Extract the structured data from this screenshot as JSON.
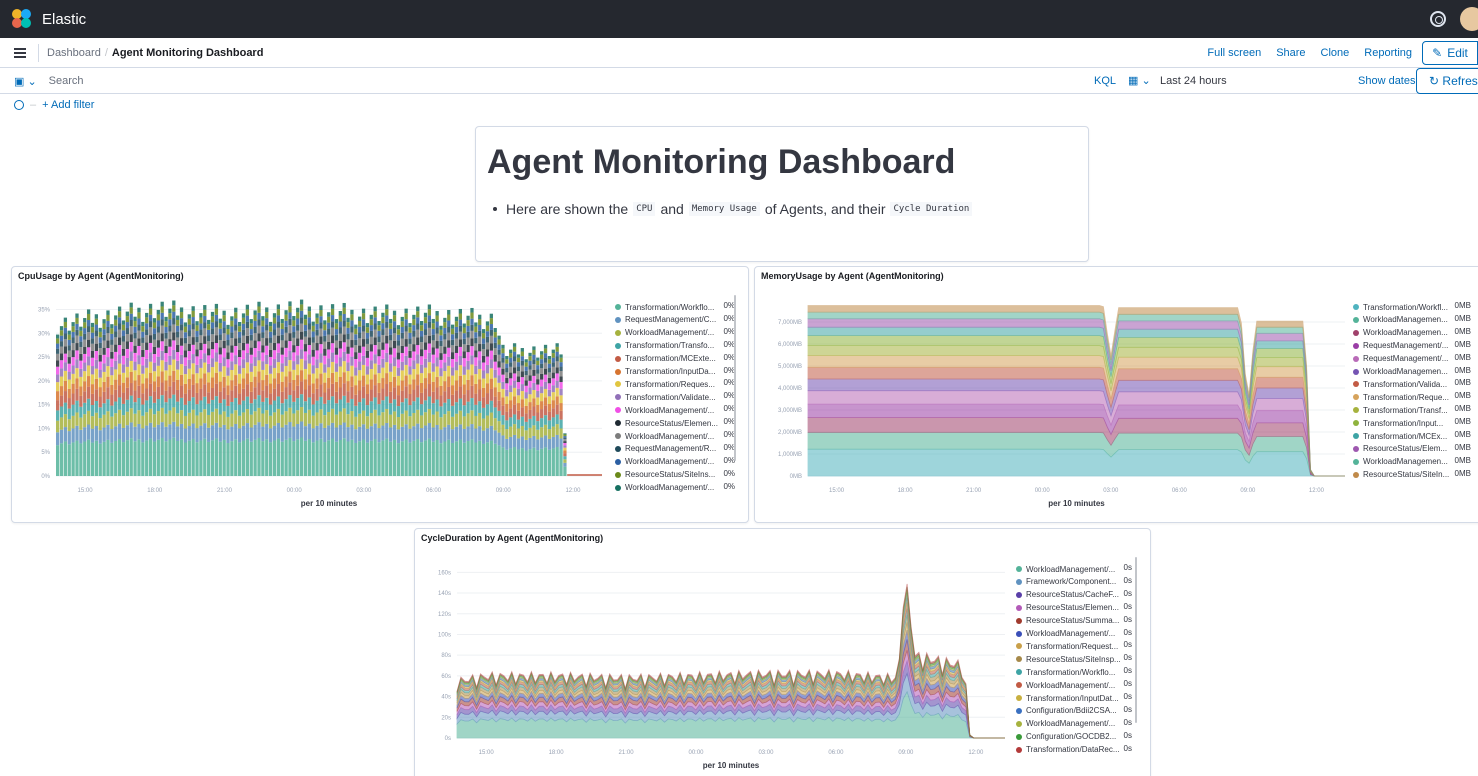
{
  "header": {
    "app_title": "Elastic"
  },
  "breadcrumbs": {
    "root": "Dashboard",
    "separator": "/",
    "current": "Agent Monitoring Dashboard"
  },
  "nav": {
    "full_screen": "Full screen",
    "share": "Share",
    "clone": "Clone",
    "reporting": "Reporting",
    "edit": "Edit"
  },
  "query": {
    "placeholder": "Search",
    "language": "KQL",
    "date_range": "Last 24 hours",
    "show_dates": "Show dates",
    "refresh": "Refresh"
  },
  "filters": {
    "add_filter": "+ Add filter"
  },
  "markdown": {
    "title": "Agent Monitoring Dashboard",
    "text_1": "Here are shown the",
    "code_1": "CPU",
    "text_2": "and",
    "code_2": "Memory Usage",
    "text_3": "of Agents, and their",
    "code_3": "Cycle Duration"
  },
  "panels": {
    "cpu": {
      "title": "CpuUsage by Agent (AgentMonitoring)",
      "legend": [
        {
          "label": "Transformation/Workflo...",
          "value": "0%",
          "color": "#54b399"
        },
        {
          "label": "RequestManagement/C...",
          "value": "0%",
          "color": "#6092c0"
        },
        {
          "label": "WorkloadManagement/...",
          "value": "0%",
          "color": "#a6b23e"
        },
        {
          "label": "Transformation/Transfo...",
          "value": "0%",
          "color": "#3ea4a5"
        },
        {
          "label": "Transformation/MCExte...",
          "value": "0%",
          "color": "#c25b45"
        },
        {
          "label": "Transformation/InputDa...",
          "value": "0%",
          "color": "#d7742f"
        },
        {
          "label": "Transformation/Reques...",
          "value": "0%",
          "color": "#e1c640"
        },
        {
          "label": "Transformation/Validate...",
          "value": "0%",
          "color": "#9170b8"
        },
        {
          "label": "WorkloadManagement/...",
          "value": "0%",
          "color": "#f04fe6"
        },
        {
          "label": "ResourceStatus/Elemen...",
          "value": "0%",
          "color": "#1f2a33"
        },
        {
          "label": "WorkloadManagement/...",
          "value": "0%",
          "color": "#7c7c7c"
        },
        {
          "label": "RequestManagement/R...",
          "value": "0%",
          "color": "#1f4a5a"
        },
        {
          "label": "WorkloadManagement/...",
          "value": "0%",
          "color": "#2c5fa3"
        },
        {
          "label": "ResourceStatus/SiteIns...",
          "value": "0%",
          "color": "#6b8a1a"
        },
        {
          "label": "WorkloadManagement/...",
          "value": "0%",
          "color": "#167061"
        }
      ]
    },
    "memory": {
      "title": "MemoryUsage by Agent (AgentMonitoring)",
      "legend": [
        {
          "label": "Transformation/Workfl...",
          "value": "0MB",
          "color": "#4fb3bf"
        },
        {
          "label": "WorkloadManagemen...",
          "value": "0MB",
          "color": "#54b399"
        },
        {
          "label": "WorkloadManagemen...",
          "value": "0MB",
          "color": "#a0416b"
        },
        {
          "label": "RequestManagement/...",
          "value": "0MB",
          "color": "#9a3ea6"
        },
        {
          "label": "RequestManagement/...",
          "value": "0MB",
          "color": "#b96bb8"
        },
        {
          "label": "WorkloadManagemen...",
          "value": "0MB",
          "color": "#7554b3"
        },
        {
          "label": "Transformation/Valida...",
          "value": "0MB",
          "color": "#c25b45"
        },
        {
          "label": "Transformation/Reque...",
          "value": "0MB",
          "color": "#d6a35c"
        },
        {
          "label": "Transformation/Transf...",
          "value": "0MB",
          "color": "#a6b23e"
        },
        {
          "label": "Transformation/Input...",
          "value": "0MB",
          "color": "#8fb33e"
        },
        {
          "label": "Transformation/MCEx...",
          "value": "0MB",
          "color": "#3ea4a5"
        },
        {
          "label": "ResourceStatus/Elem...",
          "value": "0MB",
          "color": "#9e58b0"
        },
        {
          "label": "WorkloadManagemen...",
          "value": "0MB",
          "color": "#54b399"
        },
        {
          "label": "ResourceStatus/SiteIn...",
          "value": "0MB",
          "color": "#c08a4a"
        }
      ]
    },
    "cycle": {
      "title": "CycleDuration by Agent (AgentMonitoring)",
      "legend": [
        {
          "label": "WorkloadManagement/...",
          "value": "0s",
          "color": "#54b399"
        },
        {
          "label": "Framework/Component...",
          "value": "0s",
          "color": "#6092c0"
        },
        {
          "label": "ResourceStatus/CacheF...",
          "value": "0s",
          "color": "#5a3fa8"
        },
        {
          "label": "ResourceStatus/Elemen...",
          "value": "0s",
          "color": "#b35ab8"
        },
        {
          "label": "ResourceStatus/Summa...",
          "value": "0s",
          "color": "#a03a2e"
        },
        {
          "label": "WorkloadManagement/...",
          "value": "0s",
          "color": "#3a4fb8"
        },
        {
          "label": "Transformation/Request...",
          "value": "0s",
          "color": "#c9a04a"
        },
        {
          "label": "ResourceStatus/SiteInsp...",
          "value": "0s",
          "color": "#a6894a"
        },
        {
          "label": "Transformation/Workflo...",
          "value": "0s",
          "color": "#3ea4a5"
        },
        {
          "label": "WorkloadManagement/...",
          "value": "0s",
          "color": "#c25b45"
        },
        {
          "label": "Transformation/InputDat...",
          "value": "0s",
          "color": "#c8b040"
        },
        {
          "label": "Configuration/Bdii2CSA...",
          "value": "0s",
          "color": "#3a70c0"
        },
        {
          "label": "WorkloadManagement/...",
          "value": "0s",
          "color": "#a6b23e"
        },
        {
          "label": "Configuration/GOCDB2...",
          "value": "0s",
          "color": "#3a9a3a"
        },
        {
          "label": "Transformation/DataRec...",
          "value": "0s",
          "color": "#b33a3a"
        }
      ]
    }
  },
  "chart_data": [
    {
      "type": "bar",
      "title": "CpuUsage by Agent (AgentMonitoring)",
      "xlabel": "per 10 minutes",
      "ylabel": "",
      "x_ticks": [
        "15:00",
        "18:00",
        "21:00",
        "00:00",
        "03:00",
        "06:00",
        "09:00",
        "12:00"
      ],
      "y_ticks": [
        "0%",
        "5%",
        "10%",
        "15%",
        "20%",
        "25%",
        "30%",
        "35%"
      ],
      "ylim": [
        0,
        37
      ],
      "stacked": true,
      "x_range_hours": [
        13,
        13.5
      ],
      "total_profile": [
        {
          "x": "13:45",
          "y": 29
        },
        {
          "x": "15:00",
          "y": 30
        },
        {
          "x": "18:00",
          "y": 32
        },
        {
          "x": "21:00",
          "y": 31
        },
        {
          "x": "00:00",
          "y": 32
        },
        {
          "x": "03:00",
          "y": 31
        },
        {
          "x": "06:00",
          "y": 31
        },
        {
          "x": "08:40",
          "y": 30
        },
        {
          "x": "09:00",
          "y": 24
        },
        {
          "x": "11:30",
          "y": 24
        },
        {
          "x": "11:45",
          "y": 0
        },
        {
          "x": "13:15",
          "y": 0
        }
      ]
    },
    {
      "type": "area",
      "title": "MemoryUsage by Agent (AgentMonitoring)",
      "xlabel": "per 10 minutes",
      "x_ticks": [
        "15:00",
        "18:00",
        "21:00",
        "00:00",
        "03:00",
        "06:00",
        "09:00",
        "12:00"
      ],
      "y_ticks": [
        "0MB",
        "1,000MB",
        "2,000MB",
        "3,000MB",
        "4,000MB",
        "5,000MB",
        "6,000MB",
        "7,000MB"
      ],
      "ylim": [
        0,
        8000
      ],
      "stacked": true,
      "total_profile": [
        {
          "x": "13:45",
          "y": 7600
        },
        {
          "x": "02:40",
          "y": 7600
        },
        {
          "x": "03:00",
          "y": 5300
        },
        {
          "x": "03:20",
          "y": 7500
        },
        {
          "x": "08:40",
          "y": 7500
        },
        {
          "x": "09:00",
          "y": 3000
        },
        {
          "x": "09:20",
          "y": 6900
        },
        {
          "x": "11:30",
          "y": 6900
        },
        {
          "x": "11:45",
          "y": 0
        },
        {
          "x": "13:15",
          "y": 0
        }
      ]
    },
    {
      "type": "area",
      "title": "CycleDuration by Agent (AgentMonitoring)",
      "xlabel": "per 10 minutes",
      "x_ticks": [
        "15:00",
        "18:00",
        "21:00",
        "00:00",
        "03:00",
        "06:00",
        "09:00",
        "12:00"
      ],
      "y_ticks": [
        "0s",
        "20s",
        "40s",
        "60s",
        "80s",
        "100s",
        "120s",
        "140s",
        "160s"
      ],
      "ylim": [
        0,
        170
      ],
      "stacked": true,
      "total_profile": [
        {
          "x": "13:45",
          "y": 55
        },
        {
          "x": "15:00",
          "y": 60
        },
        {
          "x": "18:00",
          "y": 60
        },
        {
          "x": "21:00",
          "y": 58
        },
        {
          "x": "00:00",
          "y": 60
        },
        {
          "x": "03:00",
          "y": 62
        },
        {
          "x": "06:00",
          "y": 62
        },
        {
          "x": "08:40",
          "y": 58
        },
        {
          "x": "09:00",
          "y": 162
        },
        {
          "x": "09:20",
          "y": 80
        },
        {
          "x": "11:30",
          "y": 70
        },
        {
          "x": "11:45",
          "y": 0
        },
        {
          "x": "13:15",
          "y": 0
        }
      ]
    }
  ]
}
